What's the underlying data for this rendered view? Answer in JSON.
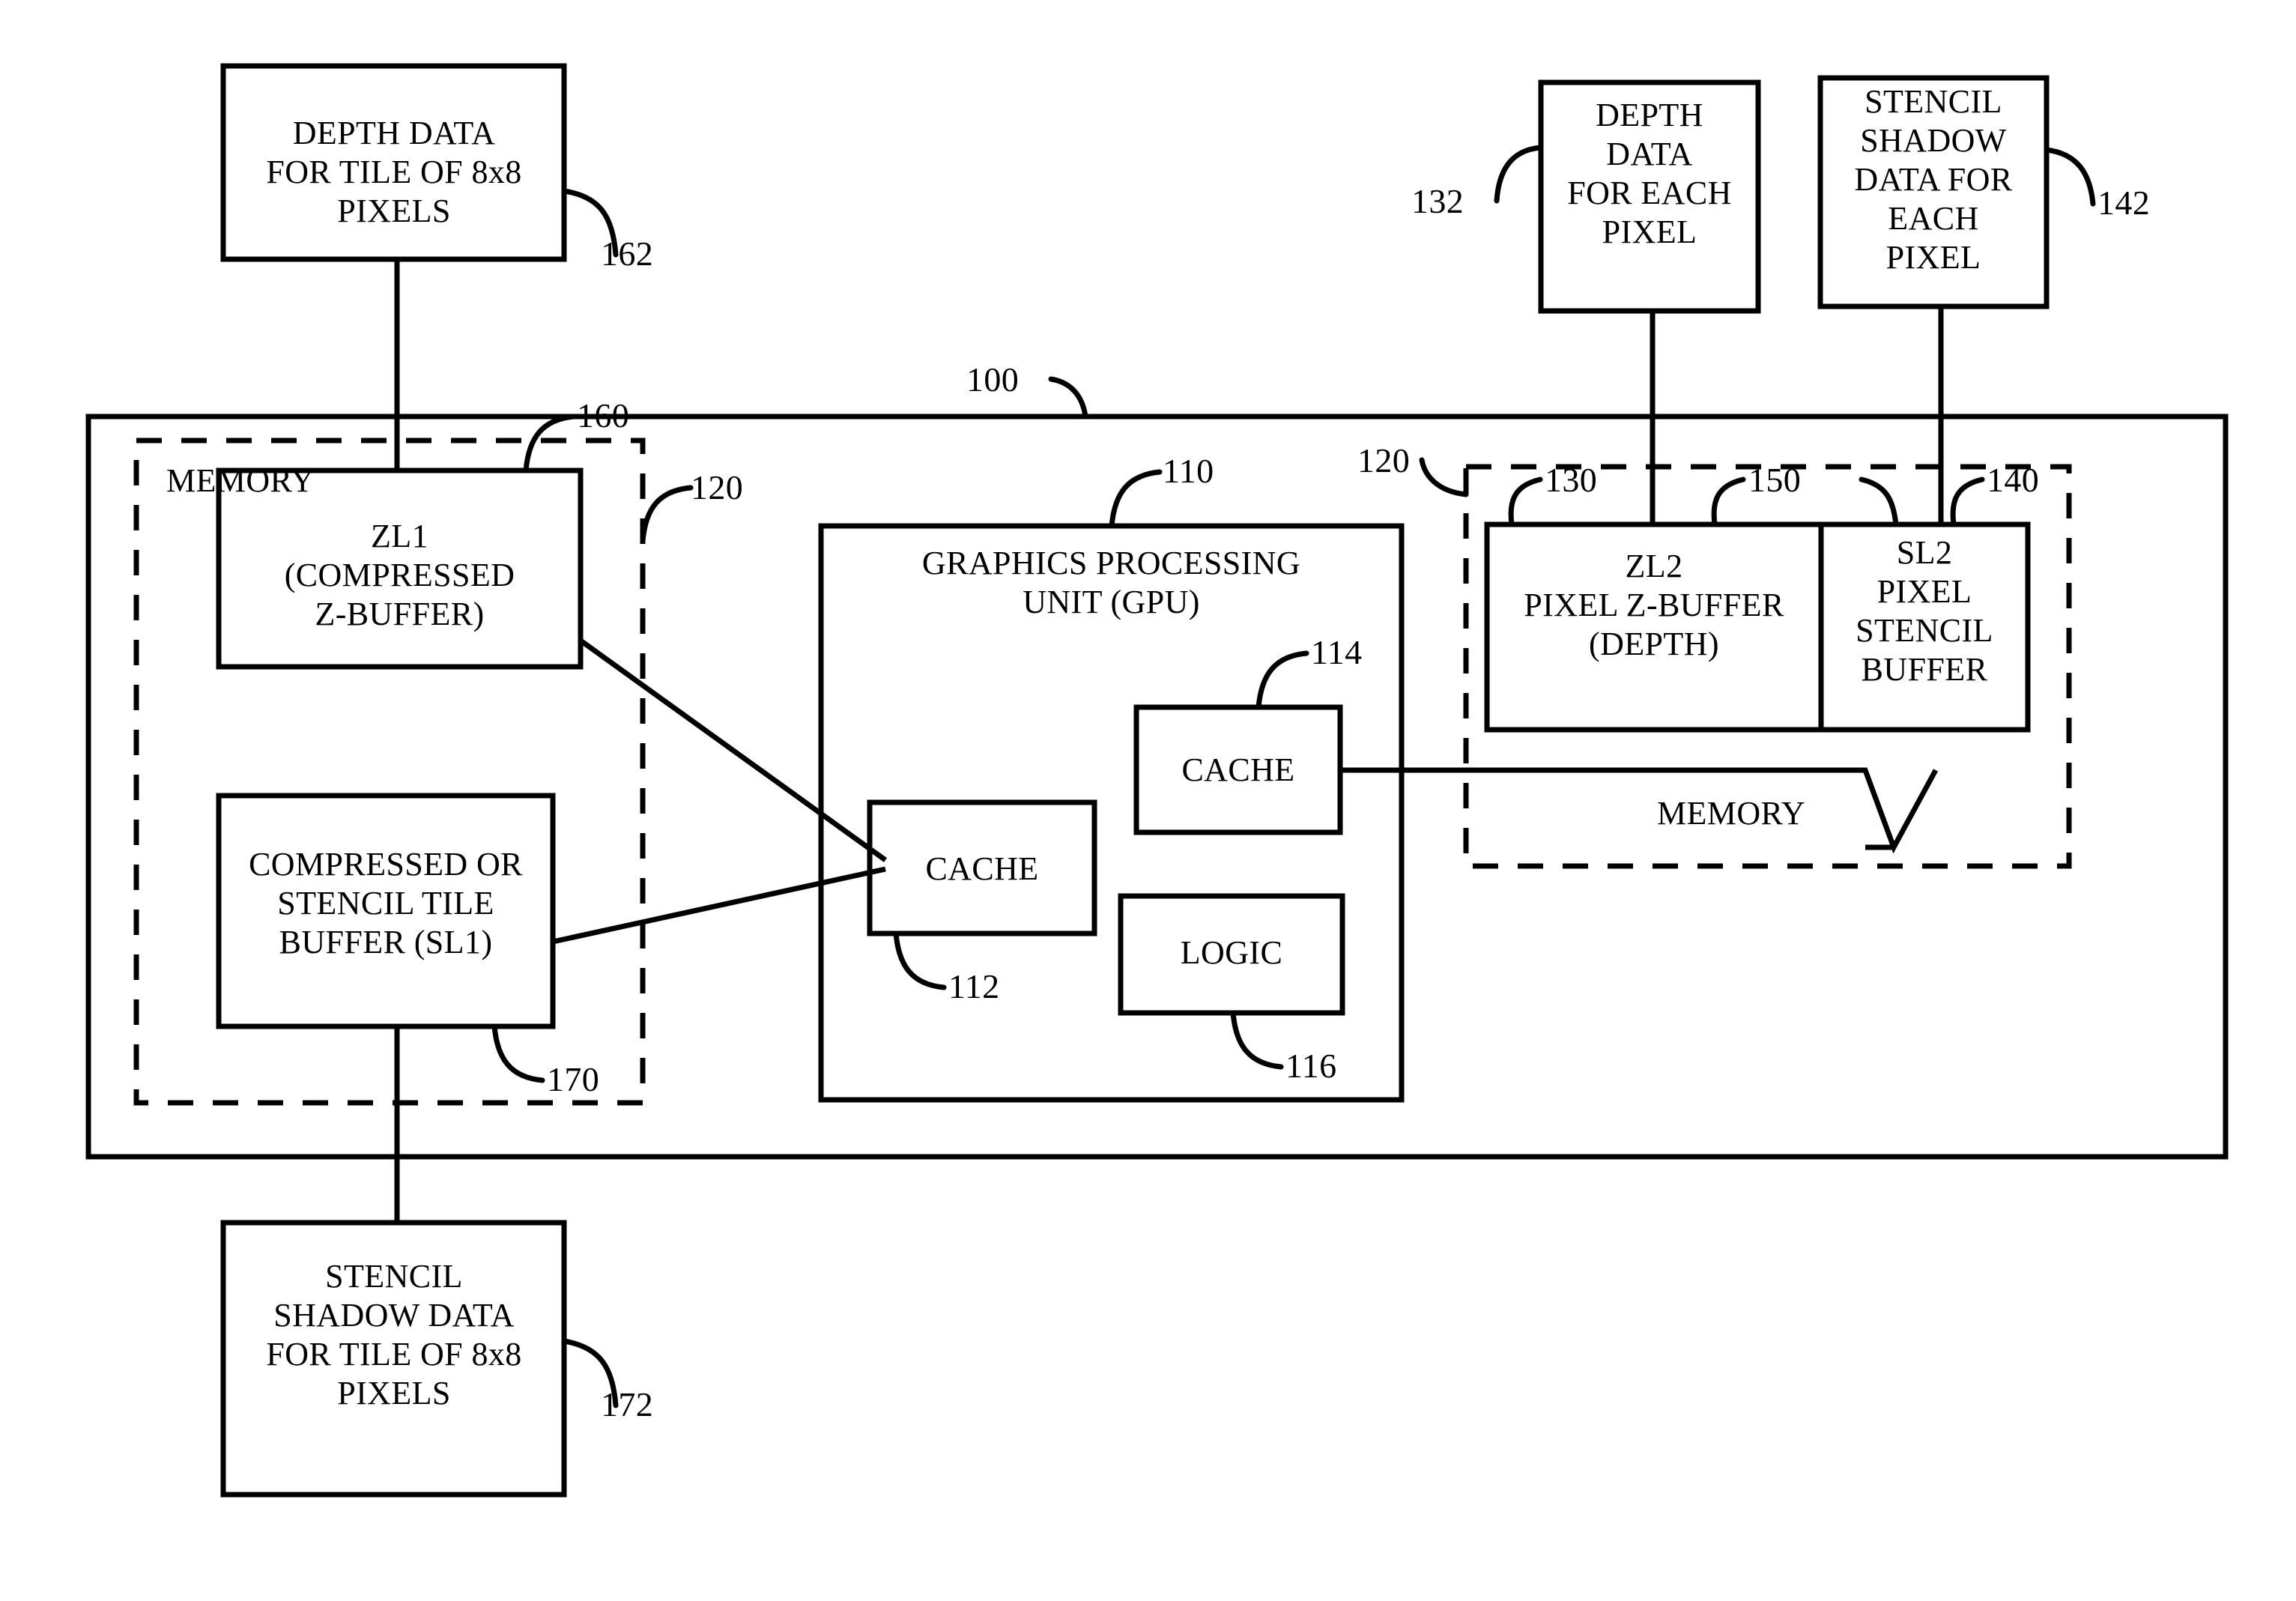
{
  "figure": {
    "type": "patent-block-diagram",
    "background": "#ffffff",
    "ink": "#000000"
  },
  "blocks": {
    "depth_tile": {
      "label": "DEPTH DATA\nFOR TILE OF 8x8\nPIXELS",
      "ref": "162"
    },
    "stencil_tile": {
      "label": "STENCIL\nSHADOW DATA\nFOR TILE OF 8x8\nPIXELS",
      "ref": "172"
    },
    "depth_each_pixel": {
      "label": "DEPTH\nDATA\nFOR EACH\nPIXEL",
      "ref": "132"
    },
    "stencil_each_pixel": {
      "label": "STENCIL\nSHADOW\nDATA FOR\nEACH\nPIXEL",
      "ref": "142"
    },
    "system": {
      "ref": "100"
    },
    "memory_left": {
      "label": "MEMORY",
      "ref": "120"
    },
    "memory_right": {
      "label": "MEMORY",
      "ref": "120"
    },
    "zl1": {
      "label": "ZL1\n(COMPRESSED\nZ-BUFFER)",
      "ref": "160"
    },
    "sl1": {
      "label": "COMPRESSED OR\nSTENCIL TILE\nBUFFER (SL1)",
      "ref": "170"
    },
    "gpu": {
      "label": "GRAPHICS PROCESSING\nUNIT (GPU)",
      "ref": "110"
    },
    "cache_112": {
      "label": "CACHE",
      "ref": "112"
    },
    "cache_114": {
      "label": "CACHE",
      "ref": "114"
    },
    "logic_116": {
      "label": "LOGIC",
      "ref": "116"
    },
    "zl2": {
      "label": "ZL2\nPIXEL Z-BUFFER\n(DEPTH)",
      "ref": "130"
    },
    "sl2": {
      "label": "SL2\nPIXEL\nSTENCIL\nBUFFER",
      "ref": "140"
    },
    "zl2_sl2_pair": {
      "ref": "150"
    }
  },
  "reference_numerals": [
    "100",
    "110",
    "112",
    "114",
    "116",
    "120",
    "130",
    "132",
    "140",
    "142",
    "150",
    "160",
    "162",
    "170",
    "172"
  ]
}
